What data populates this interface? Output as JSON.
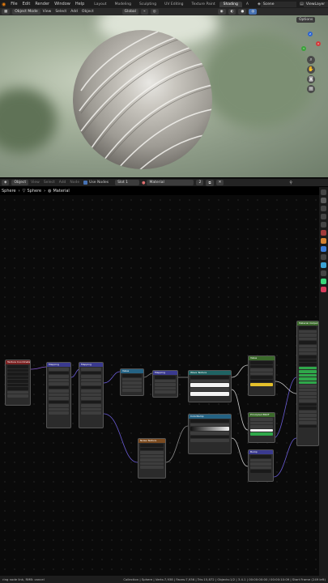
{
  "topbar": {
    "menus": [
      "File",
      "Edit",
      "Render",
      "Window",
      "Help"
    ],
    "workspaces": [
      "Layout",
      "Modeling",
      "Sculpting",
      "UV Editing",
      "Texture Paint",
      "Shading",
      "A"
    ],
    "active_workspace": "Shading",
    "scene": "Scene",
    "view_layer": "ViewLayer"
  },
  "viewport_header": {
    "mode": "Object Mode",
    "menus": [
      "View",
      "Select",
      "Add",
      "Object"
    ],
    "transform": "Global",
    "options": "Options"
  },
  "node_header": {
    "type": "Object",
    "menus": [
      "View",
      "Select",
      "Add",
      "Node"
    ],
    "use_nodes": "Use Nodes",
    "slot": "Slot 1",
    "material": "Material",
    "users": "2"
  },
  "breadcrumb": {
    "object": "Sphere",
    "mesh": "Sphere",
    "material": "Material"
  },
  "nodes": {
    "texcoord": "Texture Coordinate",
    "mapping": "Mapping",
    "value": "Value",
    "noise": "Noise Texture",
    "wave": "Wave Texture",
    "colorramp": "ColorRamp",
    "bump": "Bump",
    "bsdf": "Principled BSDF",
    "material_output": "Material Output"
  },
  "status": {
    "left": "ring node link, RMB: cancel",
    "right": "Collection | Sphere | Verts:7,938 | Faces:7,936 | Tris:15,872 | Objects:1/2 | 3.4.1 | 00:00:00:00 / 00:00:10:09 | Start Frame (249 left)"
  }
}
